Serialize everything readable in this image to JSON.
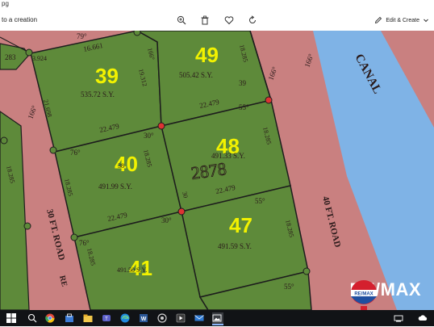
{
  "window": {
    "title": "pg"
  },
  "toolbar": {
    "left_label": "to a creation",
    "edit_create_label": "Edit & Create",
    "icons": [
      "zoom-in-icon",
      "delete-icon",
      "favorite-icon",
      "rotate-icon",
      "edit-create-icon",
      "chevron-down-icon"
    ]
  },
  "map": {
    "lots": [
      {
        "number": "39",
        "area": "535.72 S.Y."
      },
      {
        "number": "49",
        "area": "505.42 S.Y."
      },
      {
        "number": "40",
        "area": "491.99 S.Y."
      },
      {
        "number": "48",
        "area": "491.33 S.Y."
      },
      {
        "number": "47",
        "area": "491.59 S.Y."
      },
      {
        "number": "41",
        "area": "491.50 S.Y."
      }
    ],
    "dimensions": {
      "d1": "16.661",
      "d2": "3.924",
      "d3": "79°",
      "d4": "166°",
      "d5": "19.312",
      "d6": "21.698",
      "d7": "22.479",
      "d8": "22.479",
      "d9": "30°",
      "d10": "76°",
      "d11": "18.285",
      "d12": "18.285",
      "d13": "18.285",
      "d14": "22.479",
      "d15": "55°",
      "d16": "30°",
      "d17": "76°",
      "d18": "18.285",
      "d19": "22.479",
      "d20": "55°",
      "d21": "166°",
      "d22": "18.285",
      "d23": "39",
      "d24": "55°",
      "d25": "18.285",
      "d26": "166°",
      "d27": "283",
      "d28": "166°",
      "d29": "18.285",
      "d30": "30",
      "d31": "38"
    },
    "roads": {
      "canal": "CANAL",
      "road_right": "40 FT. ROAD",
      "road_left": "30 FT. ROAD",
      "road_left_suffix": "RE"
    },
    "handwritten_note": "2878",
    "lot_fill": "#5e8a3a",
    "road_fill": "#c98080",
    "canal_fill": "#7fb3e6"
  },
  "brand": {
    "name": "RE/MAX",
    "balloon_label": "RE/MAX"
  },
  "taskbar": {
    "icons": [
      "windows-start-icon",
      "search-icon",
      "chrome-icon",
      "store-icon",
      "explorer-icon",
      "teams-icon",
      "edge-icon",
      "word-icon",
      "app-icon",
      "media-icon",
      "mail-icon",
      "photos-icon",
      "tray-network-icon",
      "tray-cloud-icon"
    ]
  }
}
